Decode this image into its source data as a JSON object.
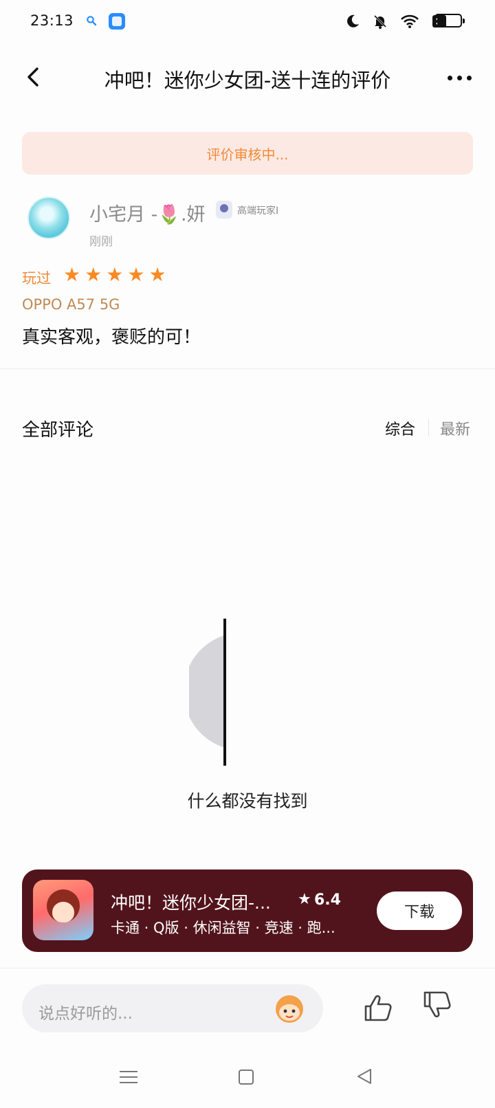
{
  "status_bar": {
    "time": "23:13"
  },
  "header": {
    "title": "冲吧！迷你少女团-送十连的评价"
  },
  "review": {
    "banner": "评价审核中...",
    "username": "小宅月 -🌷.妍",
    "user_level": "高端玩家I",
    "time": "刚刚",
    "played_label": "玩过",
    "stars": 5,
    "device": "OPPO A57 5G",
    "text": "真实客观，褒贬的可！"
  },
  "comments": {
    "title": "全部评论",
    "sort_options": [
      "综合",
      "最新"
    ],
    "empty_text": "什么都没有找到"
  },
  "game_card": {
    "name": "冲吧！迷你少女团-...",
    "score": "6.4",
    "tags": "卡通 · Q版 · 休闲益智 · 竞速 · 跑...",
    "download_label": "下载"
  },
  "bottom_bar": {
    "input_placeholder": "说点好听的..."
  },
  "colors": {
    "accent_orange": "#f08a38",
    "star_orange": "#f98a24",
    "card_background": "#52141c",
    "banner_background": "#fde9e3"
  },
  "icons": [
    "back-icon",
    "more-icon",
    "search-icon",
    "moon-icon",
    "bell-off-icon",
    "wifi-icon",
    "battery-icon",
    "emoji-icon",
    "thumbs-up-icon",
    "thumbs-down-icon"
  ]
}
